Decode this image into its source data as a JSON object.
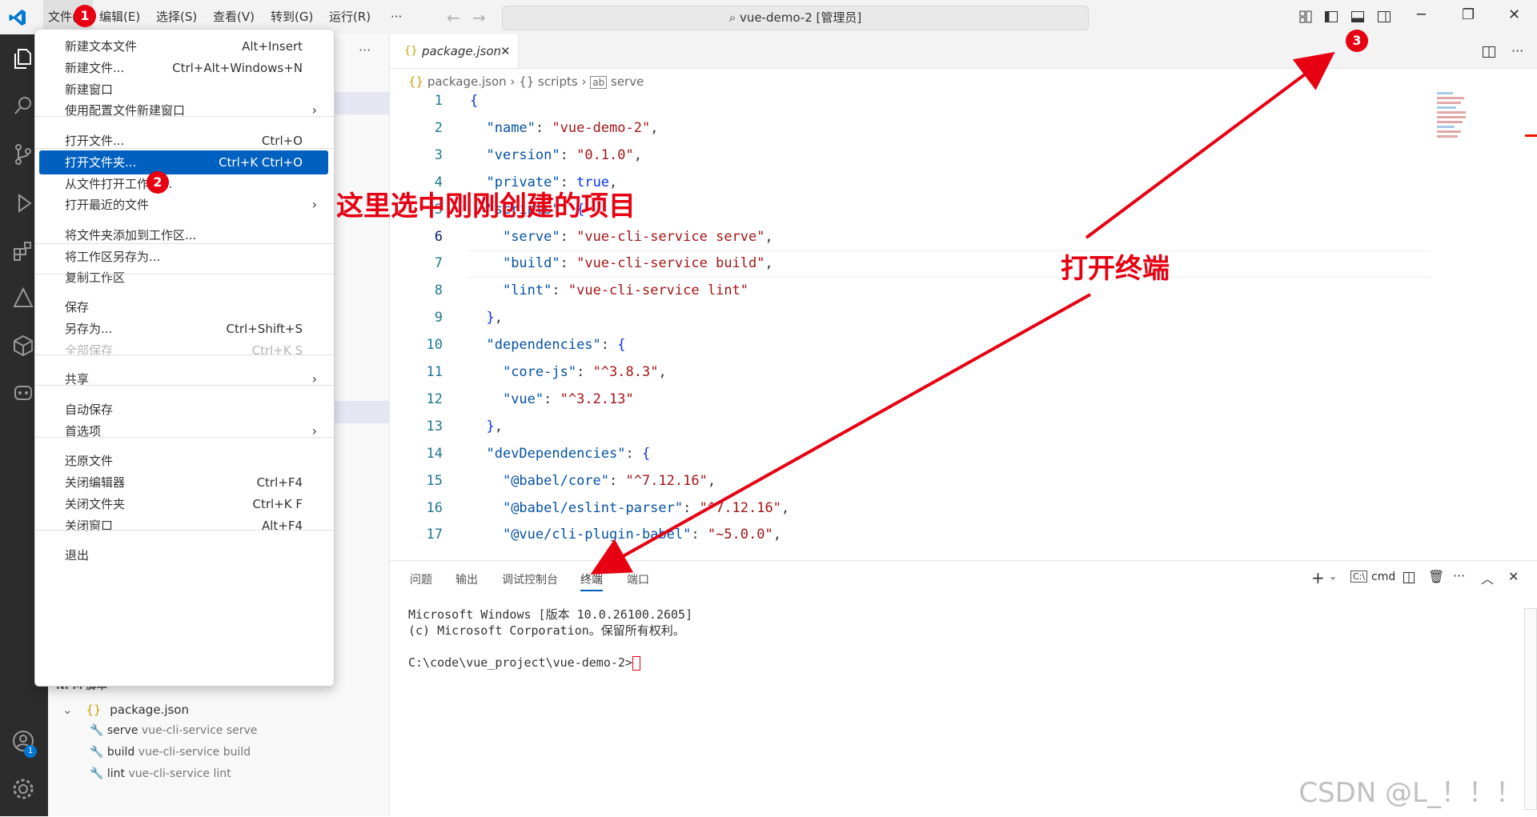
{
  "titlebar": {
    "menus": [
      "文件(F)",
      "编辑(E)",
      "选择(S)",
      "查看(V)",
      "转到(G)",
      "运行(R)",
      "···"
    ],
    "search_text": "vue-demo-2 [管理员]"
  },
  "file_menu": {
    "items": [
      {
        "label": "新建文本文件",
        "shortcut": "Alt+Insert"
      },
      {
        "label": "新建文件...",
        "shortcut": "Ctrl+Alt+Windows+N"
      },
      {
        "label": "新建窗口",
        "shortcut": ""
      },
      {
        "label": "使用配置文件新建窗口",
        "shortcut": "",
        "submenu": true
      },
      {
        "label": "打开文件...",
        "shortcut": "Ctrl+O"
      },
      {
        "label": "打开文件夹...",
        "shortcut": "Ctrl+K Ctrl+O",
        "selected": true
      },
      {
        "label": "从文件打开工作区...",
        "shortcut": ""
      },
      {
        "label": "打开最近的文件",
        "shortcut": "",
        "submenu": true
      },
      {
        "label": "将文件夹添加到工作区...",
        "shortcut": ""
      },
      {
        "label": "将工作区另存为...",
        "shortcut": ""
      },
      {
        "label": "复制工作区",
        "shortcut": ""
      },
      {
        "label": "保存",
        "shortcut": ""
      },
      {
        "label": "另存为...",
        "shortcut": "Ctrl+Shift+S"
      },
      {
        "label": "全部保存",
        "shortcut": "Ctrl+K S",
        "disabled": true
      },
      {
        "label": "共享",
        "shortcut": "",
        "submenu": true
      },
      {
        "label": "自动保存",
        "shortcut": ""
      },
      {
        "label": "首选项",
        "shortcut": "",
        "submenu": true
      },
      {
        "label": "还原文件",
        "shortcut": ""
      },
      {
        "label": "关闭编辑器",
        "shortcut": "Ctrl+F4"
      },
      {
        "label": "关闭文件夹",
        "shortcut": "Ctrl+K F"
      },
      {
        "label": "关闭窗口",
        "shortcut": "Alt+F4"
      },
      {
        "label": "退出",
        "shortcut": ""
      }
    ],
    "submenu_arrow": "›"
  },
  "annotations": {
    "badge1": "1",
    "badge2": "2",
    "badge3": "3",
    "note_folder": "这里选中刚刚创建的项目",
    "note_terminal": "打开终端",
    "annotation_color": "#e60012"
  },
  "editor": {
    "tab_label": "package.json",
    "breadcrumbs": [
      "package.json",
      "{} scripts",
      "serve"
    ],
    "lines": [
      {
        "n": "1",
        "t": "{"
      },
      {
        "n": "2",
        "t": "  \"name\": \"vue-demo-2\","
      },
      {
        "n": "3",
        "t": "  \"version\": \"0.1.0\","
      },
      {
        "n": "4",
        "t": "  \"private\": true,"
      },
      {
        "n": "5",
        "t": "  \"scripts\": {"
      },
      {
        "n": "6",
        "t": "    \"serve\": \"vue-cli-service serve\","
      },
      {
        "n": "7",
        "t": "    \"build\": \"vue-cli-service build\","
      },
      {
        "n": "8",
        "t": "    \"lint\": \"vue-cli-service lint\""
      },
      {
        "n": "9",
        "t": "  },"
      },
      {
        "n": "10",
        "t": "  \"dependencies\": {"
      },
      {
        "n": "11",
        "t": "    \"core-js\": \"^3.8.3\","
      },
      {
        "n": "12",
        "t": "    \"vue\": \"^3.2.13\""
      },
      {
        "n": "13",
        "t": "  },"
      },
      {
        "n": "14",
        "t": "  \"devDependencies\": {"
      },
      {
        "n": "15",
        "t": "    \"@babel/core\": \"^7.12.16\","
      },
      {
        "n": "16",
        "t": "    \"@babel/eslint-parser\": \"^7.12.16\","
      },
      {
        "n": "17",
        "t": "    \"@vue/cli-plugin-babel\": \"~5.0.0\","
      }
    ]
  },
  "panel": {
    "tabs": [
      "问题",
      "输出",
      "调试控制台",
      "终端",
      "端口"
    ],
    "active_tab": "终端",
    "shell": "cmd",
    "terminal_lines": [
      "Microsoft Windows [版本 10.0.26100.2605]",
      "(c) Microsoft Corporation。保留所有权利。",
      "",
      "C:\\code\\vue_project\\vue-demo-2>"
    ]
  },
  "npm_scripts": {
    "header": "NPM 脚本",
    "file": "package.json",
    "scripts": [
      {
        "name": "serve",
        "cmd": "vue-cli-service serve"
      },
      {
        "name": "build",
        "cmd": "vue-cli-service build"
      },
      {
        "name": "lint",
        "cmd": "vue-cli-service lint"
      }
    ]
  },
  "accounts_badge": "1",
  "watermark": "CSDN @L_！！！"
}
